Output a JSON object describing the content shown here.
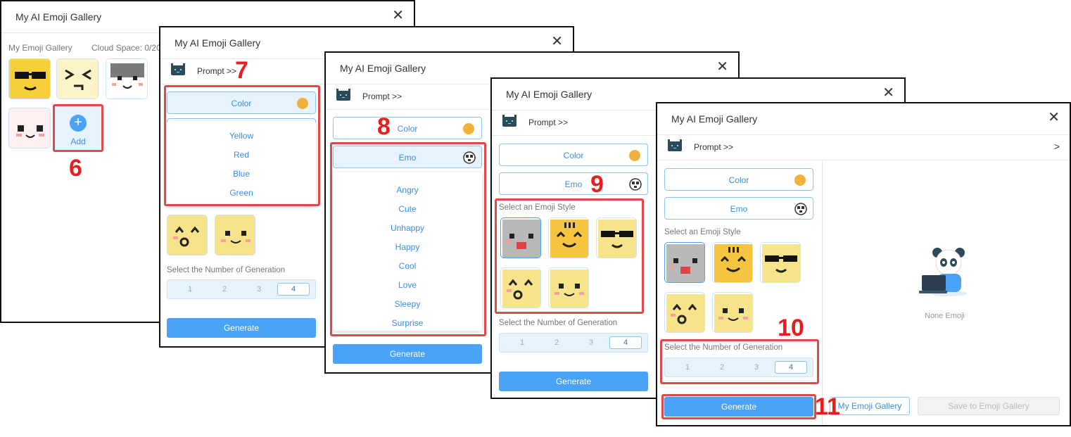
{
  "windows": {
    "title": "My AI Emoji Gallery",
    "prompt_label": "Prompt >>",
    "color_label": "Color",
    "emo_label": "Emo",
    "style_label": "Select an Emoji Style",
    "number_label": "Select the Number of Generation",
    "generate_label": "Generate",
    "numbers": [
      "1",
      "2",
      "3",
      "4"
    ],
    "selected_number": "4"
  },
  "w1": {
    "gallery_label": "My Emoji Gallery",
    "cloud_space": "Cloud Space: 0/20",
    "add_label": "Add",
    "add_icon": "+"
  },
  "colors": [
    "Yellow",
    "Red",
    "Blue",
    "Green"
  ],
  "emos": [
    "Angry",
    "Cute",
    "Unhappy",
    "Happy",
    "Cool",
    "Love",
    "Sleepy",
    "Surprise"
  ],
  "w5": {
    "none_emoji": "None Emoji",
    "my_gallery_button": "My Emoji Gallery",
    "save_button": "Save to Emoji Gallery",
    "chevron": ">"
  },
  "annotations": [
    "6",
    "7",
    "8",
    "9",
    "10",
    "11"
  ],
  "accent": "#4aa3f5",
  "highlight": "#e0484a"
}
